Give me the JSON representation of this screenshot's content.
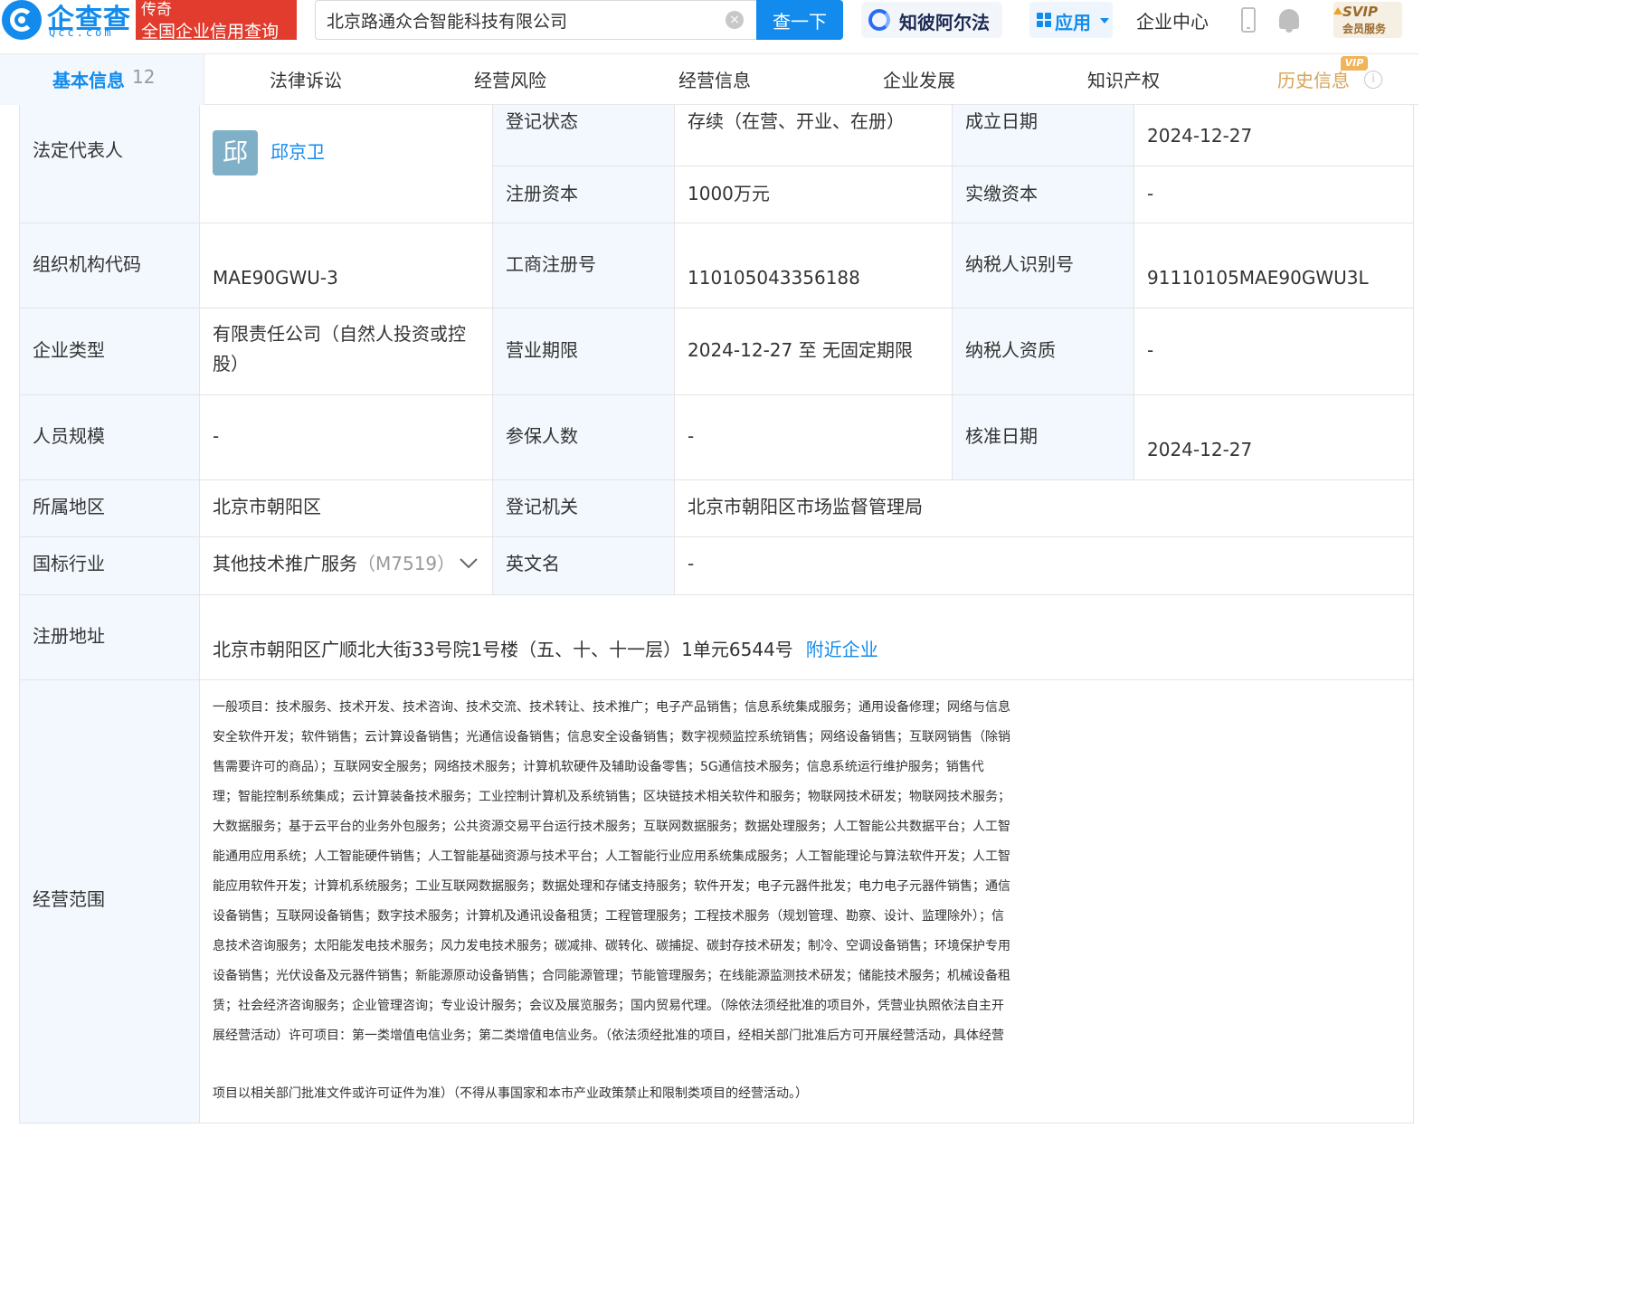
{
  "header": {
    "logo_text": "企查查",
    "logo_sub": "Qcc.com",
    "badge_line1": "传奇",
    "badge_line2": "全国企业信用查询",
    "search_value": "北京路通众合智能科技有限公司",
    "clear_glyph": "×",
    "search_button": "查一下",
    "zhibi_label": "知彼阿尔法",
    "apps_label": "应用",
    "enterprise_center": "企业中心",
    "svip_title": "SVIP",
    "svip_sub": "会员服务"
  },
  "tabs": {
    "active_label": "基本信息",
    "active_count": "12",
    "items": [
      "法律诉讼",
      "经营风险",
      "经营信息",
      "企业发展",
      "知识产权",
      "历史信息"
    ],
    "vip_badge": "VIP",
    "info_glyph": "i"
  },
  "colors": {
    "brand": "#128bed",
    "label_bg": "#f2f8fd",
    "badge_red": "#e13c2e"
  },
  "icons": [
    "logo-icon",
    "clear-icon",
    "zhibi-icon",
    "apps-grid-icon",
    "phone-icon",
    "bell-icon",
    "chevron-down-icon",
    "info-icon"
  ],
  "table": {
    "legal_rep_label": "法定代表人",
    "legal_rep_avatar": "邱",
    "legal_rep_name": "邱京卫",
    "reg_status_label": "登记状态",
    "reg_status": "存续（在营、开业、在册）",
    "founded_label": "成立日期",
    "founded": "2024-12-27",
    "reg_capital_label": "注册资本",
    "reg_capital": "1000万元",
    "paid_capital_label": "实缴资本",
    "paid_capital": "-",
    "org_code_label": "组织机构代码",
    "org_code": "MAE90GWU-3",
    "biz_reg_no_label": "工商注册号",
    "biz_reg_no": "110105043356188",
    "taxpayer_id_label": "纳税人识别号",
    "taxpayer_id": "91110105MAE90GWU3L",
    "company_type_label": "企业类型",
    "company_type_line1": "有限责任公司（自然人投资或控",
    "company_type_line2": "股）",
    "biz_term_label": "营业期限",
    "biz_term": "2024-12-27 至 无固定期限",
    "taxpayer_qual_label": "纳税人资质",
    "taxpayer_qual": "-",
    "staff_label": "人员规模",
    "staff": "-",
    "insured_label": "参保人数",
    "insured": "-",
    "approval_date_label": "核准日期",
    "approval_date": "2024-12-27",
    "region_label": "所属地区",
    "region": "北京市朝阳区",
    "reg_authority_label": "登记机关",
    "reg_authority": "北京市朝阳区市场监督管理局",
    "industry_label": "国标行业",
    "industry": "其他技术推广服务",
    "industry_code": "（M7519）",
    "english_name_label": "英文名",
    "english_name": "-",
    "address_label": "注册地址",
    "address": "北京市朝阳区广顺北大街33号院1号楼（五、十、十一层）1单元6544号",
    "nearby_link": "附近企业",
    "scope_label": "经营范围",
    "scope_lines": [
      "一般项目：技术服务、技术开发、技术咨询、技术交流、技术转让、技术推广；电子产品销售；信息系统集成服务；通用设备修理；网络与信息",
      "安全软件开发；软件销售；云计算设备销售；光通信设备销售；信息安全设备销售；数字视频监控系统销售；网络设备销售；互联网销售（除销",
      "售需要许可的商品）；互联网安全服务；网络技术服务；计算机软硬件及辅助设备零售；5G通信技术服务；信息系统运行维护服务；销售代",
      "理；智能控制系统集成；云计算装备技术服务；工业控制计算机及系统销售；区块链技术相关软件和服务；物联网技术研发；物联网技术服务；",
      "大数据服务；基于云平台的业务外包服务；公共资源交易平台运行技术服务；互联网数据服务；数据处理服务；人工智能公共数据平台；人工智",
      "能通用应用系统；人工智能硬件销售；人工智能基础资源与技术平台；人工智能行业应用系统集成服务；人工智能理论与算法软件开发；人工智",
      "能应用软件开发；计算机系统服务；工业互联网数据服务；数据处理和存储支持服务；软件开发；电子元器件批发；电力电子元器件销售；通信",
      "设备销售；互联网设备销售；数字技术服务；计算机及通讯设备租赁；工程管理服务；工程技术服务（规划管理、勘察、设计、监理除外）；信",
      "息技术咨询服务；太阳能发电技术服务；风力发电技术服务；碳减排、碳转化、碳捕捉、碳封存技术研发；制冷、空调设备销售；环境保护专用",
      "设备销售；光伏设备及元器件销售；新能源原动设备销售；合同能源管理；节能管理服务；在线能源监测技术研发；储能技术服务；机械设备租",
      "赁；社会经济咨询服务；企业管理咨询；专业设计服务；会议及展览服务；国内贸易代理。（除依法须经批准的项目外，凭营业执照依法自主开",
      "展经营活动）许可项目：第一类增值电信业务；第二类增值电信业务。（依法须经批准的项目，经相关部门批准后方可开展经营活动，具体经营"
    ],
    "scope_last_line": "项目以相关部门批准文件或许可证件为准）（不得从事国家和本市产业政策禁止和限制类项目的经营活动。）"
  }
}
